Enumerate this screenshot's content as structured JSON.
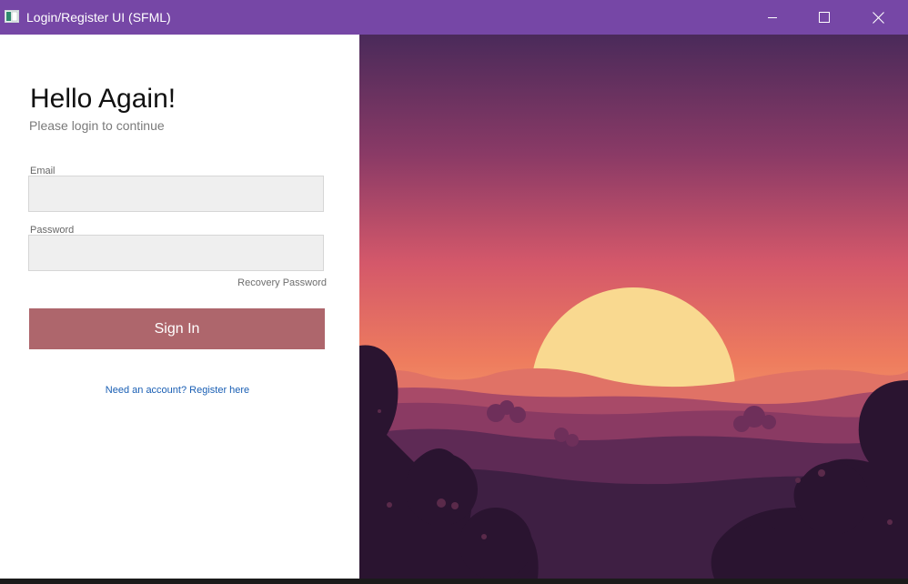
{
  "window": {
    "title": "Login/Register UI (SFML)",
    "accent_color": "#7647a6",
    "controls": [
      "minimize-icon",
      "maximize-icon",
      "close-icon"
    ]
  },
  "login": {
    "heading": "Hello Again!",
    "subheading": "Please login to continue",
    "email_label": "Email",
    "email_value": "",
    "password_label": "Password",
    "password_value": "",
    "recovery_link": "Recovery Password",
    "sign_in_button": "Sign In",
    "sign_in_color": "#ae666c",
    "register_link": "Need an account? Register here"
  },
  "scene": {
    "description_icon": "sunset-landscape-illustration",
    "sun_color": "#f9d990",
    "sky_top": "#4a2a5a",
    "sky_bottom": "#f08a5a"
  }
}
